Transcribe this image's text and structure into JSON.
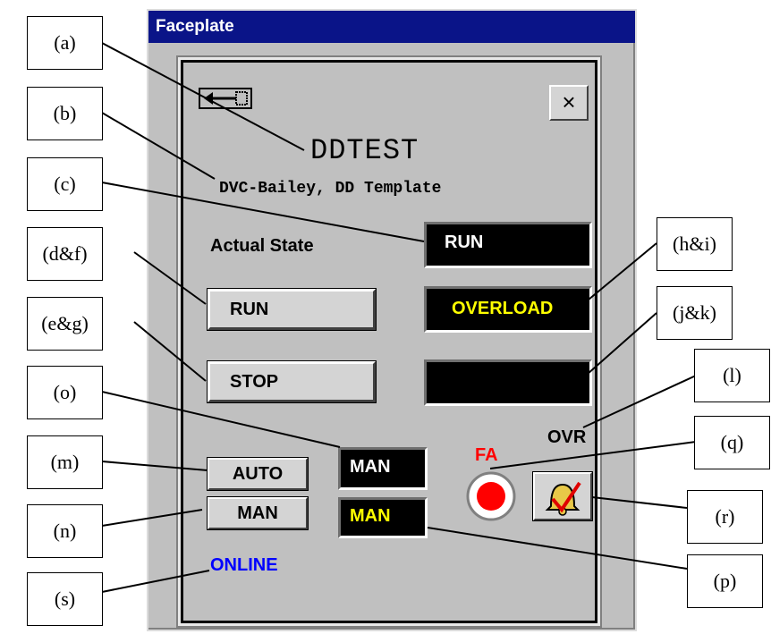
{
  "window": {
    "title": "Faceplate"
  },
  "faceplate": {
    "tag": "DDTEST",
    "description": "DVC-Bailey, DD Template",
    "actual_state_label": "Actual State",
    "actual_state_value": "RUN",
    "run_button": "RUN",
    "stop_button": "STOP",
    "status_overload": "OVERLOAD",
    "status_blank": "",
    "ovr_label": "OVR",
    "fa_label": "FA",
    "auto_button": "AUTO",
    "man_button": "MAN",
    "mode_indicator": "MAN",
    "mode_indicator_yellow": "MAN",
    "online_status": "ONLINE",
    "close_glyph": "×",
    "colors": {
      "title_bar": "#0a1488",
      "panel": "#c0c0c0",
      "overload_text": "#ffff00",
      "fa_text": "#ff0000",
      "online_text": "#0000ff",
      "indicator_light": "#ff0000"
    },
    "icons": [
      "return-arrow-icon",
      "close-icon",
      "fa-indicator-light-icon",
      "alarm-acknowledge-bell-icon"
    ]
  },
  "callouts": {
    "a": "(a)",
    "b": "(b)",
    "c": "(c)",
    "df": "(d&f)",
    "eg": "(e&g)",
    "o": "(o)",
    "m": "(m)",
    "n": "(n)",
    "s": "(s)",
    "hi": "(h&i)",
    "jk": "(j&k)",
    "l": "(l)",
    "q": "(q)",
    "r": "(r)",
    "p": "(p)"
  }
}
